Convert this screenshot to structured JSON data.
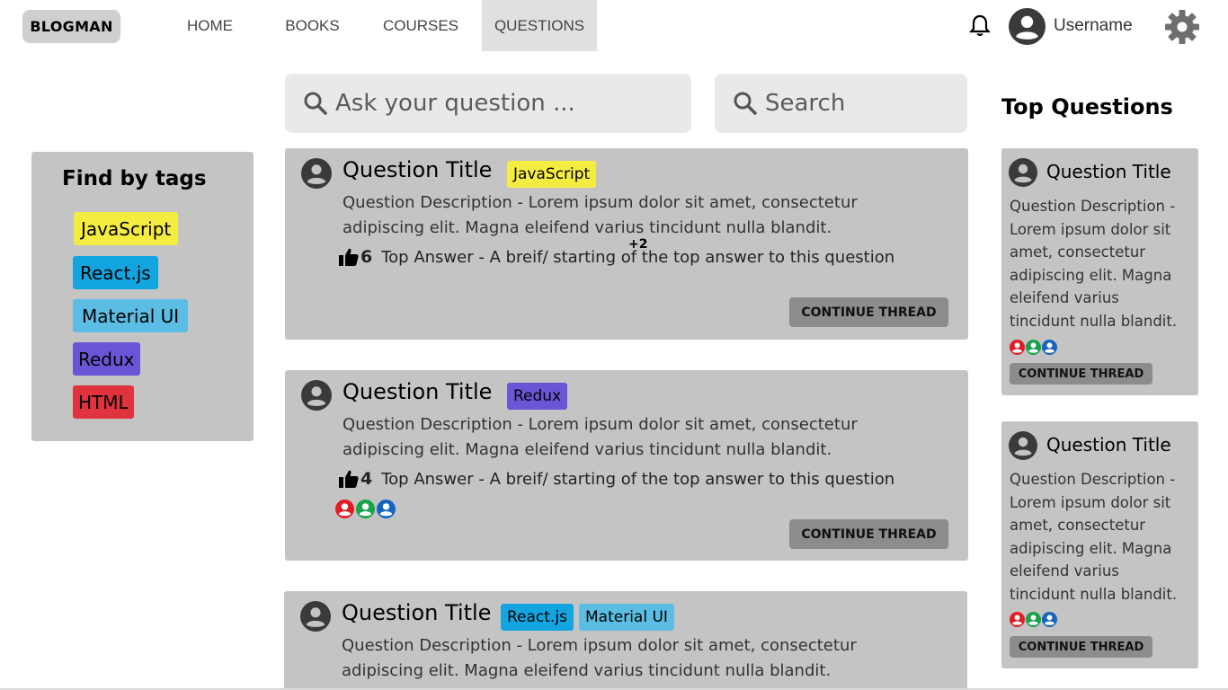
{
  "header": {
    "logo": "BLOGMAN",
    "nav": [
      "HOME",
      "BOOKS",
      "COURSES",
      "QUESTIONS"
    ],
    "active_nav": "QUESTIONS",
    "username": "Username"
  },
  "search": {
    "ask_placeholder": "Ask your question ...",
    "search_placeholder": "Search"
  },
  "tags_panel": {
    "title": "Find by tags",
    "tags": [
      {
        "label": "JavaScript",
        "color": "#f5ec42"
      },
      {
        "label": "React.js",
        "color": "#12a5e0"
      },
      {
        "label": "Material UI",
        "color": "#5bbde3"
      },
      {
        "label": "Redux",
        "color": "#6a55d6"
      },
      {
        "label": "HTML",
        "color": "#e0333e"
      }
    ]
  },
  "questions": [
    {
      "title": "Question Title",
      "chips": [
        {
          "label": "JavaScript",
          "color": "#f5ec42"
        }
      ],
      "description": "Question Description - Lorem ipsum dolor sit amet, consectetur adipiscing elit. Magna eleifend varius tincidunt nulla blandit.",
      "likes": "6",
      "top_answer": "Top Answer - A breif/ starting of the top answer to this question",
      "extra_count": "+2",
      "button": "CONTINUE THREAD"
    },
    {
      "title": "Question Title",
      "chips": [
        {
          "label": "Redux",
          "color": "#6a55d6"
        }
      ],
      "description": "Question Description - Lorem ipsum dolor sit amet, consectetur adipiscing elit. Magna eleifend varius tincidunt nulla blandit.",
      "likes": "4",
      "top_answer": "Top Answer - A breif/ starting of the top answer to this question",
      "button": "CONTINUE THREAD"
    },
    {
      "title": "Question Title",
      "chips": [
        {
          "label": "React.js",
          "color": "#12a5e0"
        },
        {
          "label": "Material UI",
          "color": "#5bbde3"
        }
      ],
      "description": "Question Description - Lorem ipsum dolor sit amet, consectetur adipiscing elit. Magna eleifend varius tincidunt nulla blandit."
    }
  ],
  "top_questions": {
    "title": "Top Questions",
    "items": [
      {
        "title": "Question Title",
        "description": "Question Description - Lorem ipsum dolor sit amet, consectetur adipiscing elit. Magna eleifend varius tincidunt nulla blandit.",
        "button": "CONTINUE THREAD"
      },
      {
        "title": "Question Title",
        "description": "Question Description - Lorem ipsum dolor sit amet, consectetur adipiscing elit. Magna eleifend varius tincidunt nulla blandit.",
        "button": "CONTINUE THREAD"
      }
    ]
  },
  "avatar_colors": [
    "#e31b23",
    "#17a34a",
    "#1565c0"
  ],
  "colors": {
    "card": "#c4c4c4",
    "button": "#8c8c8c",
    "search_bg": "#e9e9e9",
    "nav_active_bg": "#e0e0e0"
  }
}
